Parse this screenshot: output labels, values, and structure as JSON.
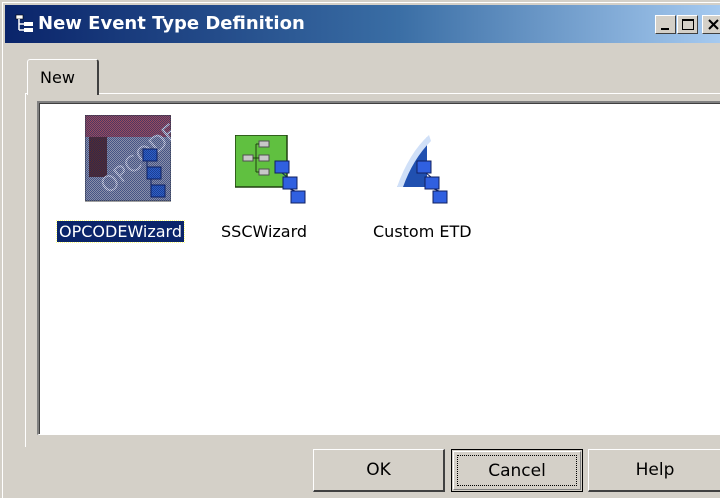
{
  "window": {
    "title": "New Event Type Definition",
    "controls": {
      "minimize_icon": "minimize-icon",
      "maximize_icon": "maximize-icon",
      "close_icon": "close-icon"
    },
    "title_gradient": [
      "#0a246a",
      "#a6caf0"
    ]
  },
  "tabs": [
    {
      "label": "New",
      "active": true
    }
  ],
  "items": [
    {
      "label": "OPCODEWizard",
      "icon": "opcode-wizard-icon",
      "selected": true
    },
    {
      "label": "SSCWizard",
      "icon": "ssc-wizard-icon",
      "selected": false
    },
    {
      "label": "Custom ETD",
      "icon": "custom-etd-icon",
      "selected": false
    }
  ],
  "buttons": {
    "ok": "OK",
    "cancel": "Cancel",
    "help": "Help"
  },
  "colors": {
    "selection": "#0a246a",
    "face": "#d4d0c8"
  }
}
